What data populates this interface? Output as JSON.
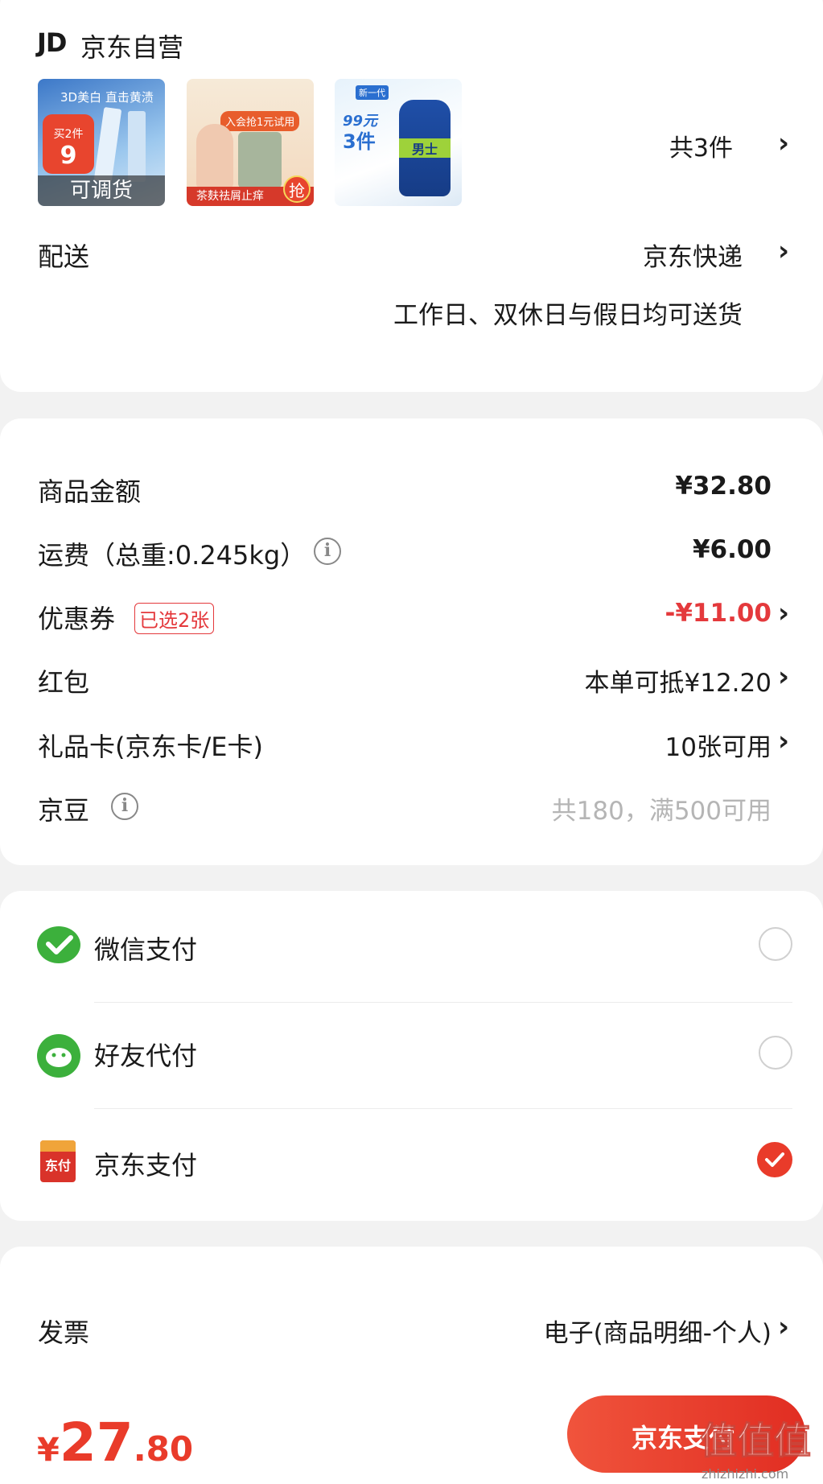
{
  "store": {
    "logo": "JD",
    "name": "京东自营"
  },
  "products": {
    "thumb1": {
      "headline": "3D美白 直击黄渍",
      "promo": "买2件",
      "price_tag": "9",
      "badge": "可调货"
    },
    "thumb2": {
      "top": "入会抢1元试用",
      "bottom": "茶麸祛屑止痒",
      "corner": "抢"
    },
    "thumb3": {
      "tag": "新一代",
      "price": "99元",
      "qty": "3件",
      "brand": "男士"
    },
    "count": "共3件"
  },
  "delivery": {
    "label": "配送",
    "method": "京东快递",
    "note": "工作日、双休日与假日均可送货"
  },
  "summary": {
    "goods_label": "商品金额",
    "goods_value": "¥32.80",
    "shipping_label": "运费（总重:0.245kg）",
    "shipping_value": "¥6.00",
    "coupon_label": "优惠券",
    "coupon_badge": "已选2张",
    "coupon_value": "-¥11.00",
    "redpacket_label": "红包",
    "redpacket_value": "本单可抵¥12.20",
    "giftcard_label": "礼品卡(京东卡/E卡)",
    "giftcard_value": "10张可用",
    "beans_label": "京豆",
    "beans_value": "共180，满500可用"
  },
  "payment": {
    "wechat": "微信支付",
    "friend": "好友代付",
    "jdpay": "京东支付",
    "jdpay_icon_text": "东付",
    "selected": "jdpay"
  },
  "invoice": {
    "label": "发票",
    "value": "电子(商品明细-个人)"
  },
  "footer": {
    "currency": "¥",
    "price_int": "27",
    "price_dec": ".80",
    "pay_button": "京东支付"
  },
  "watermark": {
    "text": "值值值",
    "domain": "zhizhizhi.com"
  },
  "colors": {
    "accent": "#e93b2a",
    "discount": "#e4393c",
    "wechat": "#3cb03c",
    "muted": "#b5b5b5"
  }
}
